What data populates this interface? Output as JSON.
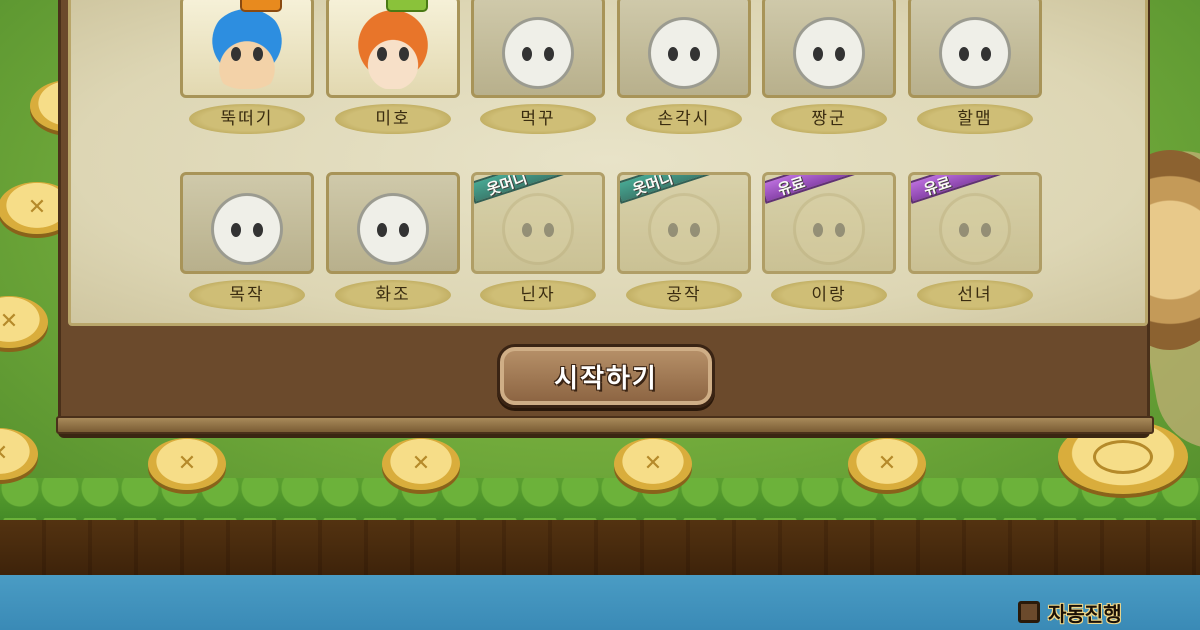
{
  "characters": [
    {
      "name": "뚝떠기",
      "style": "color",
      "tag": "orange"
    },
    {
      "name": "미호",
      "style": "color",
      "tag": "green"
    },
    {
      "name": "먹꾸",
      "style": "locked"
    },
    {
      "name": "손각시",
      "style": "locked"
    },
    {
      "name": "짱군",
      "style": "locked"
    },
    {
      "name": "할맴",
      "style": "locked"
    },
    {
      "name": "목작",
      "style": "locked"
    },
    {
      "name": "화조",
      "style": "locked"
    },
    {
      "name": "닌자",
      "style": "faded",
      "ribbon": "옷머니",
      "ribbon_color": "green"
    },
    {
      "name": "공작",
      "style": "faded",
      "ribbon": "옷머니",
      "ribbon_color": "green"
    },
    {
      "name": "이랑",
      "style": "faded",
      "ribbon": "유료",
      "ribbon_color": "purple"
    },
    {
      "name": "선녀",
      "style": "faded",
      "ribbon": "유료",
      "ribbon_color": "purple"
    }
  ],
  "start_button": {
    "label": "시작하기"
  },
  "auto_play": {
    "label": "자동진행",
    "checked": false
  },
  "colors": {
    "panel": "#6b4a2c",
    "paper": "#e8e3c8",
    "ribbon_green": "#2c9d8a",
    "ribbon_purple": "#b25ae0"
  }
}
